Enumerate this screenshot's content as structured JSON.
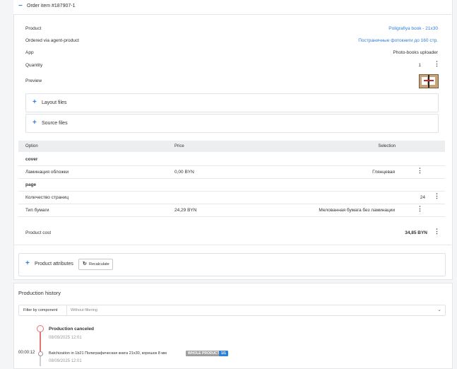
{
  "order": {
    "toggle": "−",
    "title": "Order item #187907-1",
    "fields": [
      {
        "label": "Product",
        "value": "Poligrafiya book - 21x30"
      },
      {
        "label": "Ordered via agent-product",
        "value": "Постраничные фотокниги до 160 стр."
      },
      {
        "label": "App",
        "value": "Photo-books uploader"
      },
      {
        "label": "Quantity",
        "value": "1"
      },
      {
        "label": "Preview",
        "value": ""
      }
    ],
    "expanders": [
      {
        "icon": "+",
        "label": "Layout files"
      },
      {
        "icon": "+",
        "label": "Source files"
      }
    ]
  },
  "options_table": {
    "headers": {
      "option": "Option",
      "price": "Price",
      "selection": "Selection"
    },
    "groups": [
      {
        "title": "cover",
        "rows": [
          {
            "option": "Ламинация обложки",
            "price": "0,00 BYN",
            "selection": "Глянцевая"
          }
        ]
      },
      {
        "title": "page",
        "rows": [
          {
            "option": "Количество страниц",
            "price": "",
            "selection": "24"
          },
          {
            "option": "Тип бумаги",
            "price": "24,29 BYN",
            "selection": "Мелованная бумага без ламинации"
          }
        ]
      }
    ],
    "product_cost_label": "Product cost",
    "product_cost_value": "34,85 BYN"
  },
  "attributes": {
    "icon": "+",
    "label": "Product attributes",
    "recalculate_label": "Recalculate"
  },
  "history": {
    "title": "Production history",
    "filter_label": "Filter by component",
    "filter_value": "Without filtering",
    "events": [
      {
        "time": "",
        "title": "Production canceled",
        "date": "08/09/2025 12:01"
      },
      {
        "time": "00:00:12",
        "title": "Batchization in 1b21 Полиграфическая книга 21x30, корешок 8 мм",
        "date": "08/09/2025 12:01",
        "badges": [
          "WHOLE PRODUCT",
          "1/1"
        ]
      }
    ]
  },
  "colors": {
    "accent": "#2f7ed8",
    "canceled": "#e57373",
    "badge_gray": "#9e9e9e"
  }
}
